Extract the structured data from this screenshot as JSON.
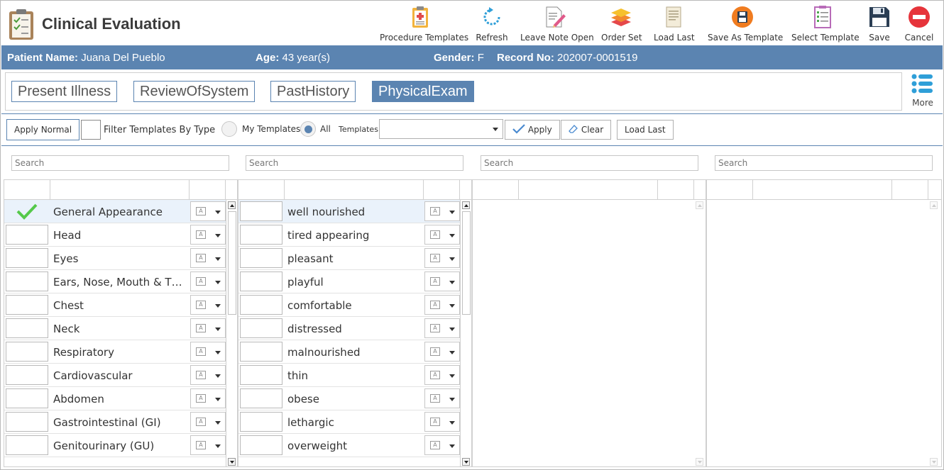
{
  "app": {
    "title": "Clinical Evaluation"
  },
  "toolbar": [
    {
      "label": "Procedure Templates",
      "icon": "clipboard-plus-icon"
    },
    {
      "label": "Refresh",
      "icon": "refresh-icon"
    },
    {
      "label": "Leave Note Open",
      "icon": "note-pencil-icon"
    },
    {
      "label": "Order Set",
      "icon": "layers-icon"
    },
    {
      "label": "Load Last",
      "icon": "document-icon"
    },
    {
      "label": "Save As Template",
      "icon": "save-circle-icon"
    },
    {
      "label": "Select Template",
      "icon": "checklist-icon"
    },
    {
      "label": "Save",
      "icon": "floppy-icon"
    },
    {
      "label": "Cancel",
      "icon": "cancel-icon"
    }
  ],
  "patient": {
    "name_label": "Patient Name:",
    "name": "Juana Del Pueblo",
    "age_label": "Age:",
    "age": "43 year(s)",
    "gender_label": "Gender:",
    "gender": "F",
    "record_label": "Record No:",
    "record": "202007-0001519"
  },
  "tabs": [
    {
      "label": "Present Illness",
      "active": false
    },
    {
      "label": "ReviewOfSystem",
      "active": false
    },
    {
      "label": "PastHistory",
      "active": false
    },
    {
      "label": "PhysicalExam",
      "active": true
    }
  ],
  "more_label": "More",
  "filter": {
    "apply_normal": "Apply Normal",
    "filter_by_type": "Filter Templates By Type",
    "my_templates": "My Templates",
    "all": "All",
    "templates_label": "Templates:",
    "templates_value": "",
    "apply": "Apply",
    "clear": "Clear",
    "load_last": "Load Last"
  },
  "search_placeholder": "Search",
  "systems": [
    {
      "name": "General Appearance",
      "checked": true
    },
    {
      "name": "Head",
      "checked": false
    },
    {
      "name": "Eyes",
      "checked": false
    },
    {
      "name": "Ears, Nose, Mouth & Thr...",
      "checked": false
    },
    {
      "name": "Chest",
      "checked": false
    },
    {
      "name": "Neck",
      "checked": false
    },
    {
      "name": "Respiratory",
      "checked": false
    },
    {
      "name": "Cardiovascular",
      "checked": false
    },
    {
      "name": "Abdomen",
      "checked": false
    },
    {
      "name": "Gastrointestinal (GI)",
      "checked": false
    },
    {
      "name": "Genitourinary (GU)",
      "checked": false
    }
  ],
  "findings": [
    {
      "name": "well nourished"
    },
    {
      "name": "tired appearing"
    },
    {
      "name": "pleasant"
    },
    {
      "name": "playful"
    },
    {
      "name": "comfortable"
    },
    {
      "name": "distressed"
    },
    {
      "name": "malnourished"
    },
    {
      "name": "thin"
    },
    {
      "name": "obese"
    },
    {
      "name": "lethargic"
    },
    {
      "name": "overweight"
    }
  ],
  "colors": {
    "accent": "#5b84b1",
    "check": "#55c94a",
    "selected_row": "#eaf2fb"
  }
}
